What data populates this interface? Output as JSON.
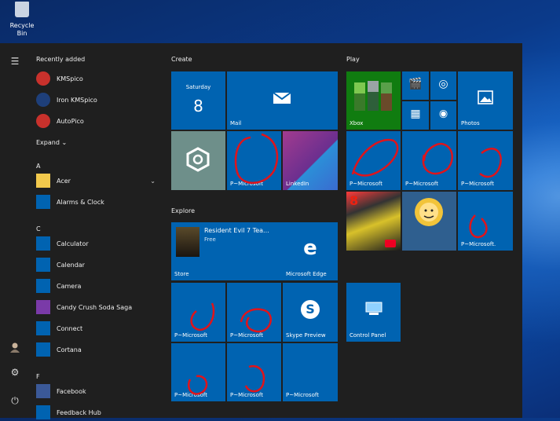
{
  "desktop": {
    "recycle_bin_label": "Recycle Bin"
  },
  "applist": {
    "recently_added_title": "Recently added",
    "recent": [
      {
        "label": "KMSpico",
        "icon": "kmspico-icon",
        "color": "#c8312c"
      },
      {
        "label": "Iron KMSpico",
        "icon": "iron-kmspico-icon",
        "color": "#1e3f7a"
      },
      {
        "label": "AutoPico",
        "icon": "autopico-icon",
        "color": "#c8312c"
      }
    ],
    "expand_label": "Expand",
    "sections": [
      {
        "letter": "A",
        "items": [
          {
            "label": "Acer",
            "icon": "folder-icon",
            "color": "#f2c94c",
            "has_chevron": true
          },
          {
            "label": "Alarms & Clock",
            "icon": "alarm-icon",
            "color": "#0063b1"
          }
        ]
      },
      {
        "letter": "C",
        "items": [
          {
            "label": "Calculator",
            "icon": "calculator-icon",
            "color": "#0063b1"
          },
          {
            "label": "Calendar",
            "icon": "calendar-icon",
            "color": "#0063b1"
          },
          {
            "label": "Camera",
            "icon": "camera-icon",
            "color": "#0063b1"
          },
          {
            "label": "Candy Crush Soda Saga",
            "icon": "candy-icon",
            "color": "#7a3aa8"
          },
          {
            "label": "Connect",
            "icon": "connect-icon",
            "color": "#0063b1"
          },
          {
            "label": "Cortana",
            "icon": "cortana-icon",
            "color": "#0063b1"
          }
        ]
      },
      {
        "letter": "F",
        "items": [
          {
            "label": "Facebook",
            "icon": "facebook-icon",
            "color": "#3b5998"
          },
          {
            "label": "Feedback Hub",
            "icon": "feedback-icon",
            "color": "#0063b1"
          }
        ]
      }
    ]
  },
  "groups": {
    "create": "Create",
    "play": "Play",
    "explore": "Explore"
  },
  "tiles": {
    "calendar": {
      "day": "Saturday",
      "date": "8"
    },
    "mail": {
      "label": "Mail"
    },
    "settings_label": "",
    "pmicrosoft": "P~Microsoft",
    "pmicrosoft_dot": "P~Microsoft.",
    "linkedin": "LinkedIn",
    "xbox": {
      "label": "Xbox"
    },
    "photos": {
      "label": "Photos"
    },
    "store": {
      "title": "Resident Evil 7 Tea...",
      "sub": "Free",
      "label": "Store"
    },
    "edge": {
      "label": "Microsoft Edge"
    },
    "skype": {
      "label": "Skype Preview"
    },
    "control_panel": {
      "label": "Control Panel"
    }
  },
  "colors": {
    "tile_blue": "#0063b1",
    "menu_bg": "#1f1f1f",
    "scribble": "#e0141b"
  }
}
